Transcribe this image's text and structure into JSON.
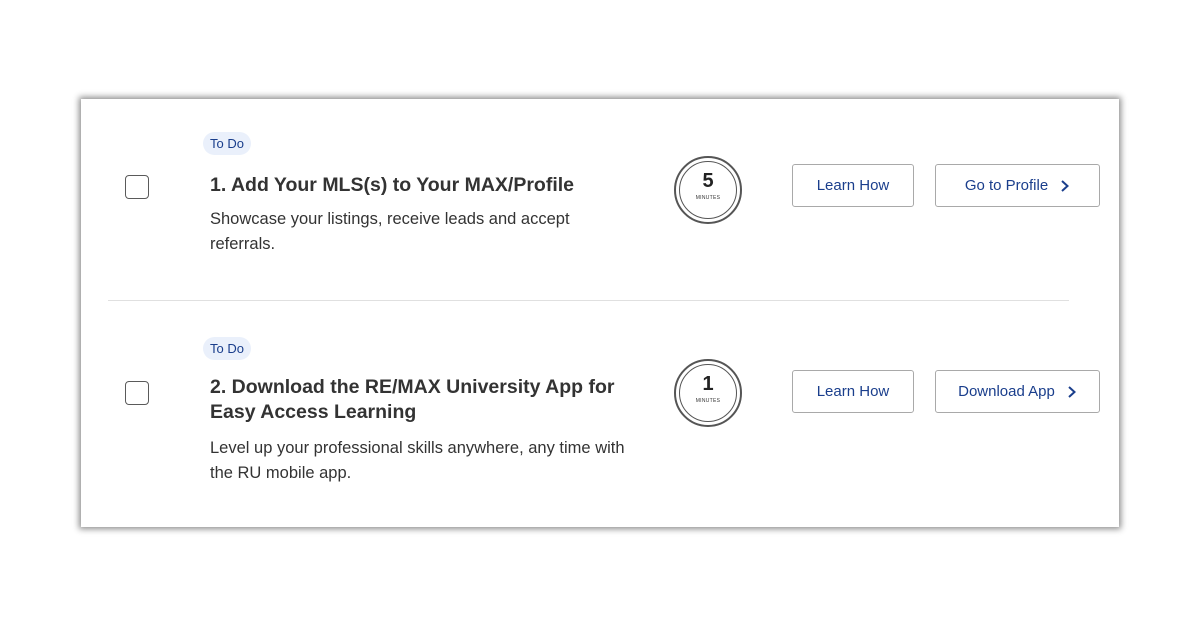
{
  "tasks": [
    {
      "status": "To Do",
      "title": "1. Add Your MLS(s) to Your MAX/Profile",
      "description": "Showcase your listings, receive leads and accept referrals.",
      "minutes": "5",
      "minutes_label": "MINUTES",
      "learn_label": "Learn How",
      "action_label": "Go to Profile",
      "action_icon": "chevron-right-icon"
    },
    {
      "status": "To Do",
      "title": "2. Download the RE/MAX University App for Easy Access Learning",
      "description": "Level up your professional skills anywhere, any time with the RU mobile app.",
      "minutes": "1",
      "minutes_label": "MINUTES",
      "learn_label": "Learn How",
      "action_label": "Download App",
      "action_icon": "chevron-right-icon"
    }
  ],
  "colors": {
    "accent": "#1a3e8c",
    "badge_bg": "#eaf0fb",
    "text": "#333333",
    "border": "#a9a9a9"
  }
}
